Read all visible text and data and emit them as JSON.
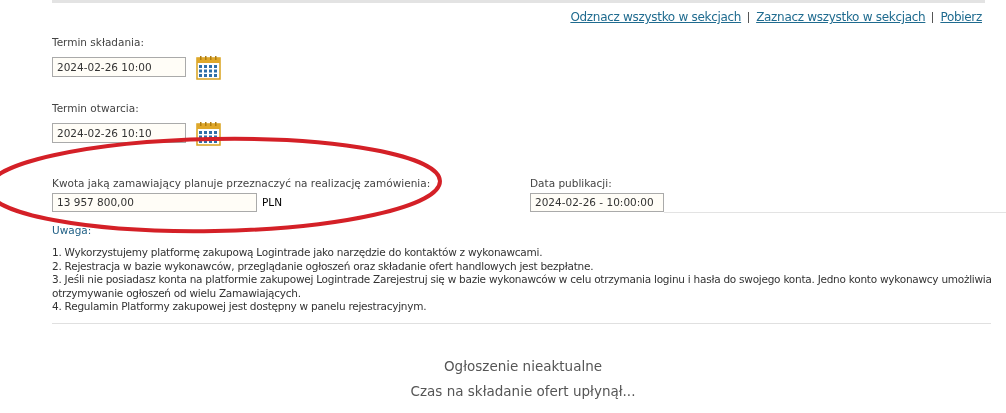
{
  "links": [
    "Odznacz wszystko w sekcjach",
    "Zaznacz wszystko w sekcjach",
    "Pobierz"
  ],
  "date_fields": [
    {
      "label": "Termin składania:",
      "value": "2024-02-26 10:00"
    },
    {
      "label": "Termin otwarcia:",
      "value": "2024-02-26 10:10"
    }
  ],
  "amount": {
    "label": "Kwota jaką zamawiający planuje przeznaczyć na realizację zamówienia:",
    "value": "13 957 800,00",
    "currency": "PLN"
  },
  "publication": {
    "label": "Data publikacji:",
    "value": "2024-02-26 - 10:00:00"
  },
  "notes": {
    "title": "Uwaga:",
    "items": [
      "1. Wykorzystujemy platformę zakupową Logintrade jako narzędzie do kontaktów z wykonawcami.",
      "2. Rejestracja w bazie wykonawców, przeglądanie ogłoszeń oraz składanie ofert handlowych jest bezpłatne.",
      "3. Jeśli nie posiadasz konta na platformie zakupowej Logintrade Zarejestruj się w bazie wykonawców w celu otrzymania loginu i hasła do swojego konta. Jedno konto wykonawcy umożliwia otrzymywanie ogłoszeń od wielu Zamawiających.",
      "4. Regulamin Platformy zakupowej jest dostępny w panelu rejestracyjnym."
    ]
  },
  "status": [
    "Ogłoszenie nieaktualne",
    "Czas na składanie ofert upłynął..."
  ]
}
